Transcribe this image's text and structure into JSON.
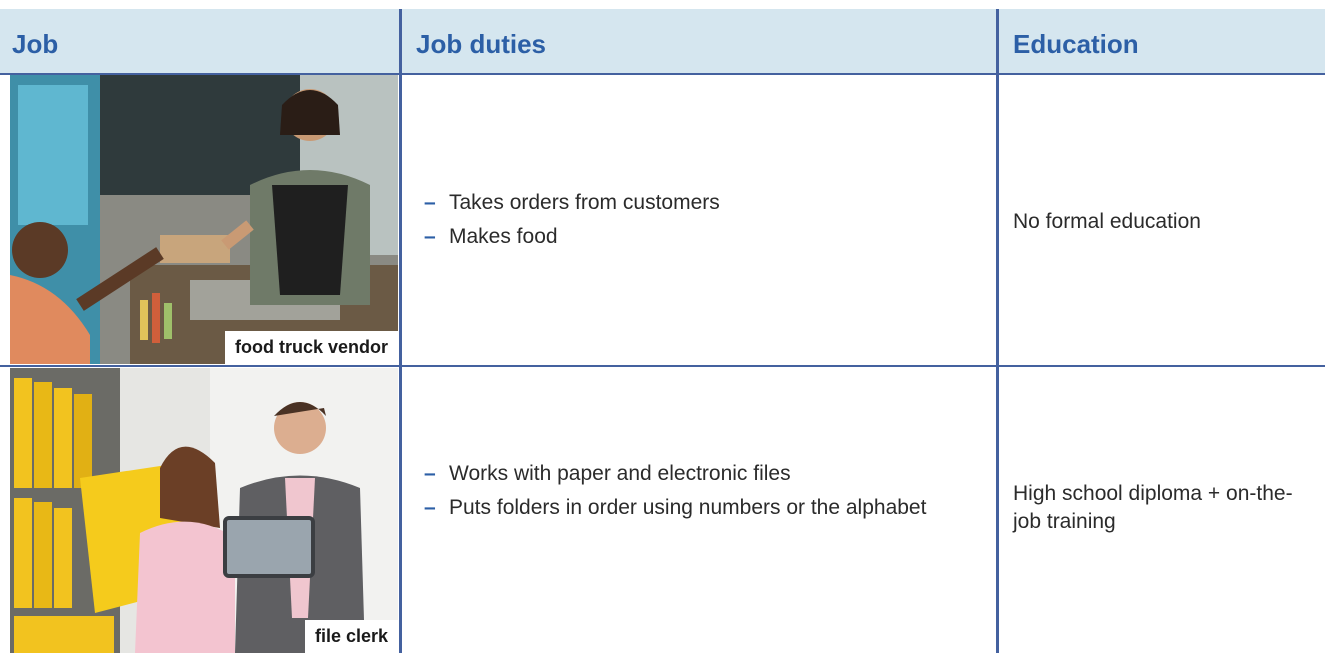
{
  "table": {
    "headers": [
      "Job",
      "Job duties",
      "Education"
    ],
    "rows": [
      {
        "job": "food truck vendor",
        "duties": [
          "Takes orders from customers",
          "Makes food"
        ],
        "education": "No formal education",
        "photo": "photo of a smiling vendor handing a food box to a customer from a food truck"
      },
      {
        "job": "file clerk",
        "duties": [
          "Works with paper and electronic files",
          "Puts folders in order using numbers or the alphabet"
        ],
        "education": "High school diploma + on-the-job training",
        "photo": "photo of two office workers with yellow binders and a tablet"
      }
    ]
  },
  "bullet_glyph": "–",
  "colors": {
    "header_bg": "#d5e6ef",
    "header_text": "#2c5fa6",
    "rule": "#44619f",
    "bullet": "#2c5fa6"
  }
}
